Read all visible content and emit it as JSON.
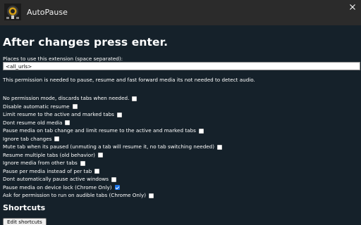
{
  "window": {
    "title": "AutoPause",
    "icon": "autopause-app-icon",
    "close_icon": "close-icon"
  },
  "main": {
    "heading": "After changes press enter.",
    "places": {
      "label": "Places to use this extension (space separated):",
      "value": "<all_urls>"
    },
    "permission_note": "This permission is needed to pause, resume and fast forward media its not needed to detect audio.",
    "options": [
      {
        "label": "No permission mode, discards tabs when needed.",
        "checked": false
      },
      {
        "label": "Disable automatic resume",
        "checked": false
      },
      {
        "label": "Limit resume to the active and marked tabs",
        "checked": false
      },
      {
        "label": "Dont resume old media",
        "checked": false
      },
      {
        "label": "Pause media on tab change and limit resume to the active and marked tabs",
        "checked": false
      },
      {
        "label": "Ignore tab changes",
        "checked": false
      },
      {
        "label": "Mute tab when its paused (unmuting a tab will resume it, no tab switching needed)",
        "checked": false
      },
      {
        "label": "Resume multiple tabs (old behavior)",
        "checked": false
      },
      {
        "label": "Ignore media from other tabs",
        "checked": false
      },
      {
        "label": "Pause per media instead of per tab",
        "checked": false
      },
      {
        "label": "Dont automatically pause active windows",
        "checked": false
      },
      {
        "label": "Pause media on device lock (Chrome Only)",
        "checked": true
      },
      {
        "label": "Ask for permission to run on audible tabs (Chrome Only)",
        "checked": false
      }
    ],
    "shortcuts": {
      "heading": "Shortcuts",
      "button_label": "Edit shortcuts"
    }
  },
  "colors": {
    "background": "#15212a",
    "titlebar": "#2b2b2b",
    "checkbox_accent": "#1a73e8"
  }
}
